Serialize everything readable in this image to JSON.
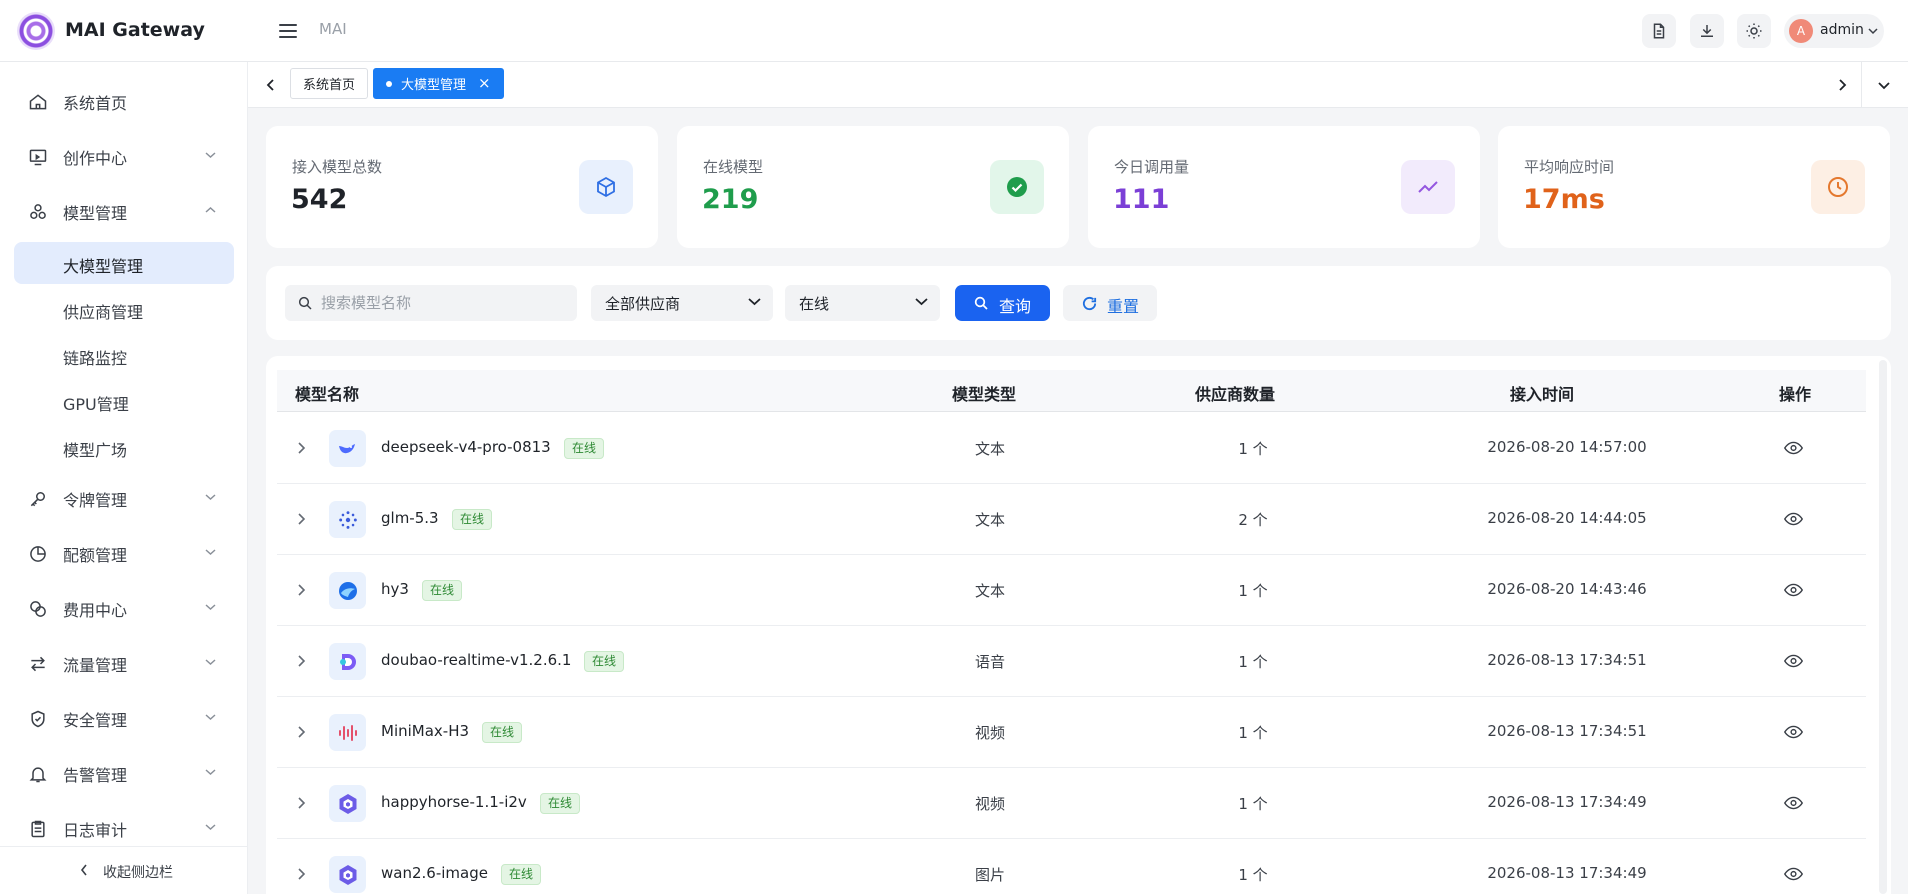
{
  "app": {
    "title": "MAI Gateway",
    "breadcrumb": "MAI"
  },
  "user": {
    "avatar_letter": "A",
    "name": "admin"
  },
  "colors": {
    "primary": "#1a63f0",
    "accent_tab": "#1a7cf3",
    "online_green": "#1f9d4c",
    "purple": "#7b3fd6",
    "orange": "#e0621a"
  },
  "sidebar": {
    "items": [
      {
        "label": "系统首页",
        "icon": "home-icon"
      },
      {
        "label": "创作中心",
        "icon": "monitor-icon"
      },
      {
        "label": "模型管理",
        "icon": "cubes-icon"
      },
      {
        "label": "令牌管理",
        "icon": "key-icon"
      },
      {
        "label": "配额管理",
        "icon": "pie-icon"
      },
      {
        "label": "费用中心",
        "icon": "coins-icon"
      },
      {
        "label": "流量管理",
        "icon": "swap-icon"
      },
      {
        "label": "安全管理",
        "icon": "shield-icon"
      },
      {
        "label": "告警管理",
        "icon": "bell-icon"
      },
      {
        "label": "日志审计",
        "icon": "clipboard-icon"
      }
    ],
    "submenu": [
      "大模型管理",
      "供应商管理",
      "链路监控",
      "GPU管理",
      "模型广场"
    ],
    "collapse_label": "收起侧边栏"
  },
  "tabs": [
    {
      "label": "系统首页"
    },
    {
      "label": "大模型管理"
    }
  ],
  "stats": [
    {
      "label": "接入模型总数",
      "value": "542",
      "icon": "cube-icon"
    },
    {
      "label": "在线模型",
      "value": "219",
      "icon": "check-circle-icon"
    },
    {
      "label": "今日调用量",
      "value": "111",
      "icon": "trend-icon"
    },
    {
      "label": "平均响应时间",
      "value": "17ms",
      "icon": "clock-icon"
    }
  ],
  "filters": {
    "search_placeholder": "搜索模型名称",
    "provider": "全部供应商",
    "status": "在线",
    "query_label": "查询",
    "reset_label": "重置"
  },
  "table": {
    "headers": [
      "模型名称",
      "模型类型",
      "供应商数量",
      "接入时间",
      "操作"
    ],
    "rows": [
      {
        "name": "deepseek-v4-pro-0813",
        "status": "在线",
        "type": "文本",
        "providers": "1 个",
        "time": "2026-08-20 14:57:00",
        "icon": "deepseek-logo-icon"
      },
      {
        "name": "glm-5.3",
        "status": "在线",
        "type": "文本",
        "providers": "2 个",
        "time": "2026-08-20 14:44:05",
        "icon": "glm-logo-icon"
      },
      {
        "name": "hy3",
        "status": "在线",
        "type": "文本",
        "providers": "1 个",
        "time": "2026-08-20 14:43:46",
        "icon": "hunyuan-logo-icon"
      },
      {
        "name": "doubao-realtime-v1.2.6.1",
        "status": "在线",
        "type": "语音",
        "providers": "1 个",
        "time": "2026-08-13 17:34:51",
        "icon": "doubao-logo-icon"
      },
      {
        "name": "MiniMax-H3",
        "status": "在线",
        "type": "视频",
        "providers": "1 个",
        "time": "2026-08-13 17:34:51",
        "icon": "minimax-logo-icon"
      },
      {
        "name": "happyhorse-1.1-i2v",
        "status": "在线",
        "type": "视频",
        "providers": "1 个",
        "time": "2026-08-13 17:34:49",
        "icon": "qwen-logo-icon"
      },
      {
        "name": "wan2.6-image",
        "status": "在线",
        "type": "图片",
        "providers": "1 个",
        "time": "2026-08-13 17:34:49",
        "icon": "qwen-logo-icon"
      }
    ]
  }
}
